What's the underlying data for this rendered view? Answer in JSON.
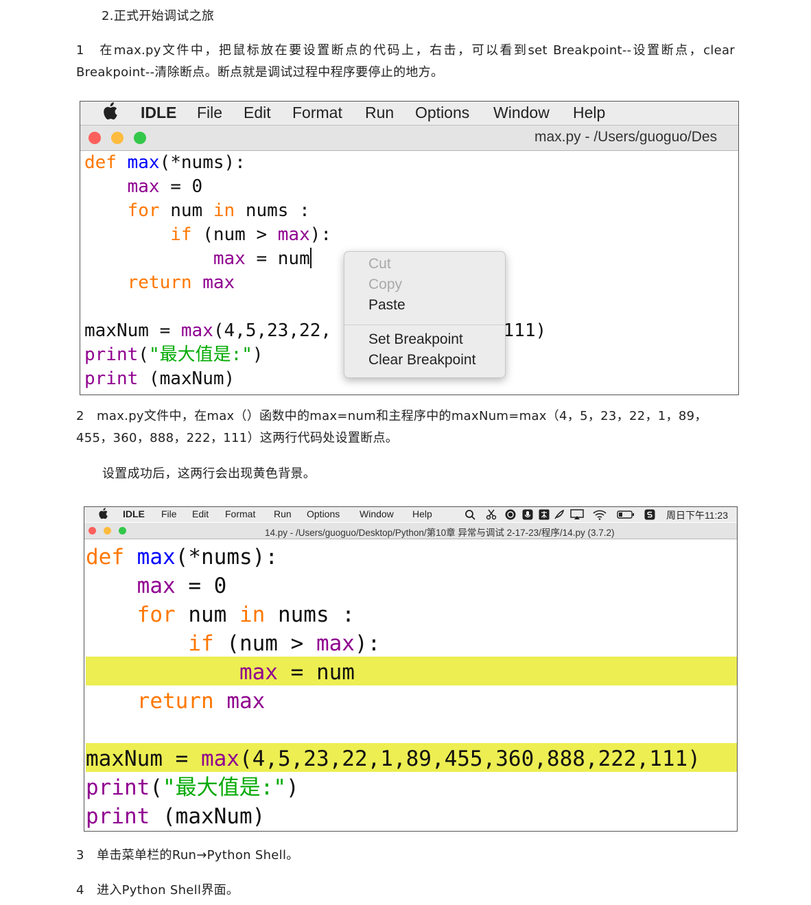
{
  "doc": {
    "title": "2.正式开始调试之旅",
    "step1": "1　在max.py文件中，把鼠标放在要设置断点的代码上，右击，可以看到set Breakpoint--设置断点，clear Breakpoint--清除断点。断点就是调试过程中程序要停止的地方。",
    "step2": "2　max.py文件中，在max（）函数中的max=num和主程序中的maxNum=max（4，5，23，22，1，89，455，360，888，222，111）这两行代码处设置断点。",
    "note": "设置成功后，这两行会出现黄色背景。",
    "step3": "3　单击菜单栏的Run→Python Shell。",
    "step4": "4　进入Python Shell界面。"
  },
  "menu": {
    "app": "IDLE",
    "file": "File",
    "edit": "Edit",
    "format": "Format",
    "run": "Run",
    "options": "Options",
    "window": "Window",
    "help": "Help"
  },
  "window1": {
    "title": "max.py - /Users/guoguo/Des"
  },
  "window2": {
    "title": "14.py - /Users/guoguo/Desktop/Python/第10章 异常与调试 2-17-23/程序/14.py (3.7.2)",
    "clock": "周日下午11:23"
  },
  "context_menu": {
    "cut": "Cut",
    "copy": "Copy",
    "paste": "Paste",
    "set_breakpoint": "Set Breakpoint",
    "clear_breakpoint": "Clear Breakpoint"
  },
  "code": {
    "def": "def",
    "max": "max",
    "nums_sig": "(*nums):",
    "assign_zero": " = 0",
    "for": "for",
    "num_sp": " num ",
    "in": "in",
    "nums_colon": " nums :",
    "if": "if",
    "cond_open": " (num > ",
    "cond_close": "):",
    "assign_num": " = num",
    "return": "return",
    "maxnum_assign": "maxNum = ",
    "args": "(4,5,23,22,1,89,455,360,888,222,111)",
    "args_left": "(4,5,23,22,",
    "args_right": "88,222,111)",
    "print": "print",
    "paren_open": "(",
    "str_label": "\"最大值是:\"",
    "paren_close": ")",
    "print_arg": " (maxNum)"
  },
  "colors": {
    "keyword": "#ff7700",
    "builtin": "#900090",
    "defname": "#0000ff",
    "string": "#00aa00",
    "breakpoint_bg": "#ecee52"
  }
}
